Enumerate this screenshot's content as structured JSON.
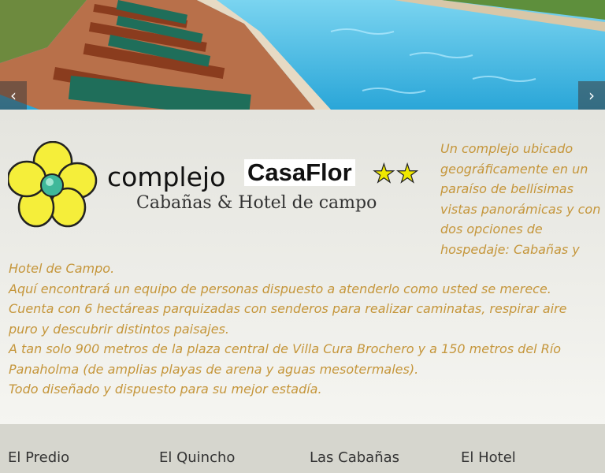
{
  "slider": {
    "prev_icon": "chevron-left-icon",
    "next_icon": "chevron-right-icon",
    "prev_glyph": "‹",
    "next_glyph": "›"
  },
  "logo": {
    "word": "complejo",
    "brand": "CasaFlor",
    "stars": "★★",
    "subtitle": "Cabañas & Hotel de campo",
    "flower_color": "#f5ee3a",
    "center_color": "#3fb89a"
  },
  "intro": "Un complejo ubicado geográficamente en un paraíso de bellísimas vistas panorámicas y con dos opciones de hospedaje: Cabañas y",
  "body_lines": [
    "Hotel de Campo.",
    "Aquí encontrará un equipo de personas dispuesto a atenderlo como usted se merece.",
    "Cuenta con 6 hectáreas parquizadas con senderos para realizar caminatas, respirar aire puro y descubrir distintos paisajes.",
    "A tan solo 900 metros de la plaza central de Villa Cura Brochero y a 150 metros del Río Panaholma (de amplias playas de arena y aguas mesotermales).",
    "Todo diseñado y dispuesto para su mejor estadía."
  ],
  "nav": {
    "items": [
      "El Predio",
      "El Quincho",
      "Las Cabañas",
      "El Hotel"
    ]
  },
  "colors": {
    "text_accent": "#c5963b",
    "nav_bg": "#d6d6ce",
    "pool": "#3fb7e0"
  }
}
